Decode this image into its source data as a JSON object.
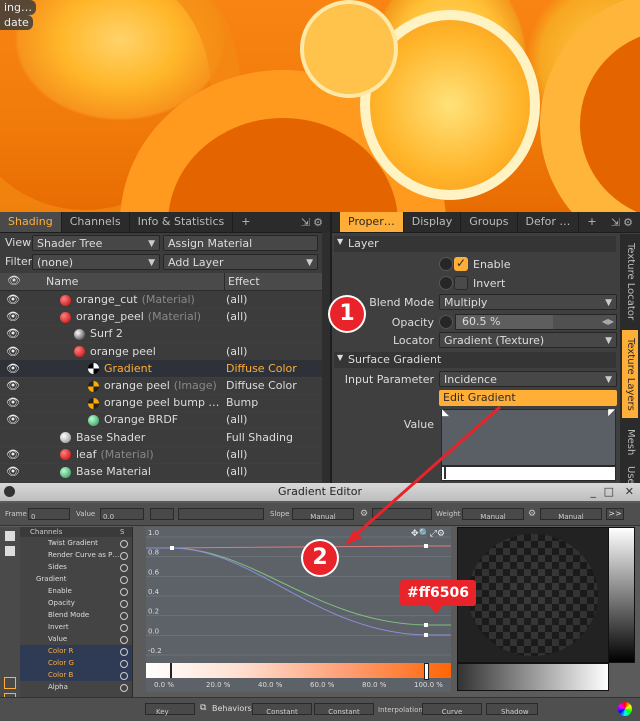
{
  "viewport": {
    "overlay_lines": [
      "ing…",
      "date"
    ]
  },
  "left_panel": {
    "tabs": [
      "Shading",
      "Channels",
      "Info & Statistics",
      "+"
    ],
    "view_label": "View",
    "view_value": "Shader Tree",
    "assign_material": "Assign Material",
    "filter_label": "Filter",
    "filter_value": "(none)",
    "add_layer": "Add Layer",
    "col_name": "Name",
    "col_effect": "Effect",
    "rows": [
      {
        "indent": 0,
        "icon": "material",
        "name": "orange_cut",
        "type": "(Material)",
        "effect": "(all)"
      },
      {
        "indent": 0,
        "icon": "material",
        "name": "orange_peel",
        "type": "(Material)",
        "effect": "(all)"
      },
      {
        "indent": 1,
        "icon": "surf",
        "name": "Surf 2",
        "type": "",
        "effect": ""
      },
      {
        "indent": 1,
        "icon": "material",
        "name": "orange peel",
        "type": "",
        "effect": "(all)"
      },
      {
        "indent": 2,
        "icon": "gradient",
        "name": "Gradient",
        "type": "",
        "effect": "Diffuse Color"
      },
      {
        "indent": 2,
        "icon": "image",
        "name": "orange peel",
        "type": "(Image)",
        "effect": "Diffuse Color"
      },
      {
        "indent": 2,
        "icon": "image",
        "name": "orange peel bump …",
        "type": "",
        "effect": "Bump"
      },
      {
        "indent": 2,
        "icon": "brdf",
        "name": "Orange BRDF",
        "type": "",
        "effect": "(all)"
      },
      {
        "indent": 0,
        "icon": "shader",
        "name": "Base Shader",
        "type": "",
        "effect": "Full Shading"
      },
      {
        "indent": 0,
        "icon": "material",
        "name": "leaf",
        "type": "(Material)",
        "effect": "(all)"
      },
      {
        "indent": 0,
        "icon": "brdf",
        "name": "Base Material",
        "type": "",
        "effect": "(all)"
      }
    ]
  },
  "right_panel": {
    "tabs": [
      "Proper…",
      "Display",
      "Groups",
      "Defor …",
      "+"
    ],
    "side_tabs": [
      "Texture Locator",
      "Texture Layers",
      "Mesh",
      "Use"
    ],
    "layer_section": "Layer",
    "enable_label": "Enable",
    "invert_label": "Invert",
    "blend_mode_label": "Blend Mode",
    "blend_mode_value": "Multiply",
    "opacity_label": "Opacity",
    "opacity_value": "60.5 %",
    "opacity_fraction": 0.605,
    "locator_label": "Locator",
    "locator_value": "Gradient (Texture)",
    "surface_gradient_section": "Surface Gradient",
    "input_param_label": "Input Parameter",
    "input_param_value": "Incidence",
    "edit_gradient": "Edit Gradient",
    "value_label": "Value"
  },
  "gradient_editor": {
    "title": "Gradient Editor",
    "toolbar": {
      "frame_label": "Frame",
      "frame_value": "0",
      "value_label": "Value",
      "value_value": "0.0",
      "slope_label": "Slope",
      "slope_value": "Manual",
      "weight_label": "Weight",
      "weight_value": "Manual",
      "weight_value2": "Manual"
    },
    "channels_header": "Channels",
    "channels_s": "S",
    "channels": [
      "Twist Gradient",
      "Render Curve as P…",
      "Sides",
      "Gradient",
      "Enable",
      "Opacity",
      "Blend Mode",
      "Invert",
      "Value",
      "Color R",
      "Color G",
      "Color B",
      "Alpha"
    ],
    "y_ticks": [
      "1.0",
      "0.8",
      "0.6",
      "0.4",
      "0.2",
      "0.0",
      "-0.2"
    ],
    "x_ticks": [
      "0.0 %",
      "20.0 %",
      "40.0 %",
      "60.0 %",
      "80.0 %",
      "100.0 %"
    ],
    "color_annotation": "#ff6506",
    "bottom_bar": {
      "key": "Key",
      "behaviors": "Behaviors",
      "constant1": "Constant",
      "constant2": "Constant",
      "interpolation": "Interpolation",
      "curve": "Curve",
      "shadow": "Shadow"
    }
  },
  "callouts": [
    "1",
    "2"
  ],
  "colors": {
    "accent": "#ffae37",
    "callout": "#e8232a",
    "gradient_end": "#ff6506"
  }
}
